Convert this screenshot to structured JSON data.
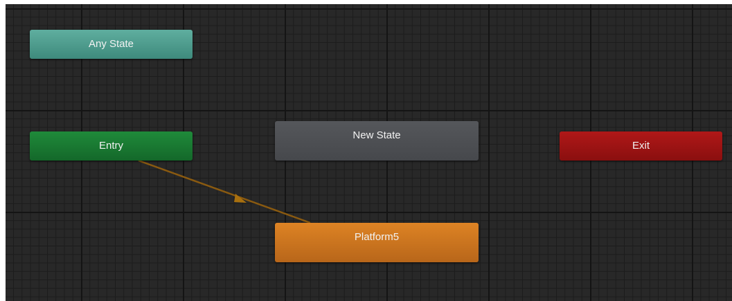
{
  "nodes": {
    "any_state": "Any State",
    "entry": "Entry",
    "new_state": "New State",
    "exit": "Exit",
    "platform5": "Platform5"
  },
  "colors": {
    "canvas": "#282828",
    "any_state": "#4f9c8d",
    "entry": "#187a32",
    "new_state": "#4d4f53",
    "exit": "#9c1414",
    "default_state": "#cc7620",
    "transition": "#8a5a10"
  },
  "transitions": [
    {
      "from": "Entry",
      "to": "Platform5"
    }
  ]
}
